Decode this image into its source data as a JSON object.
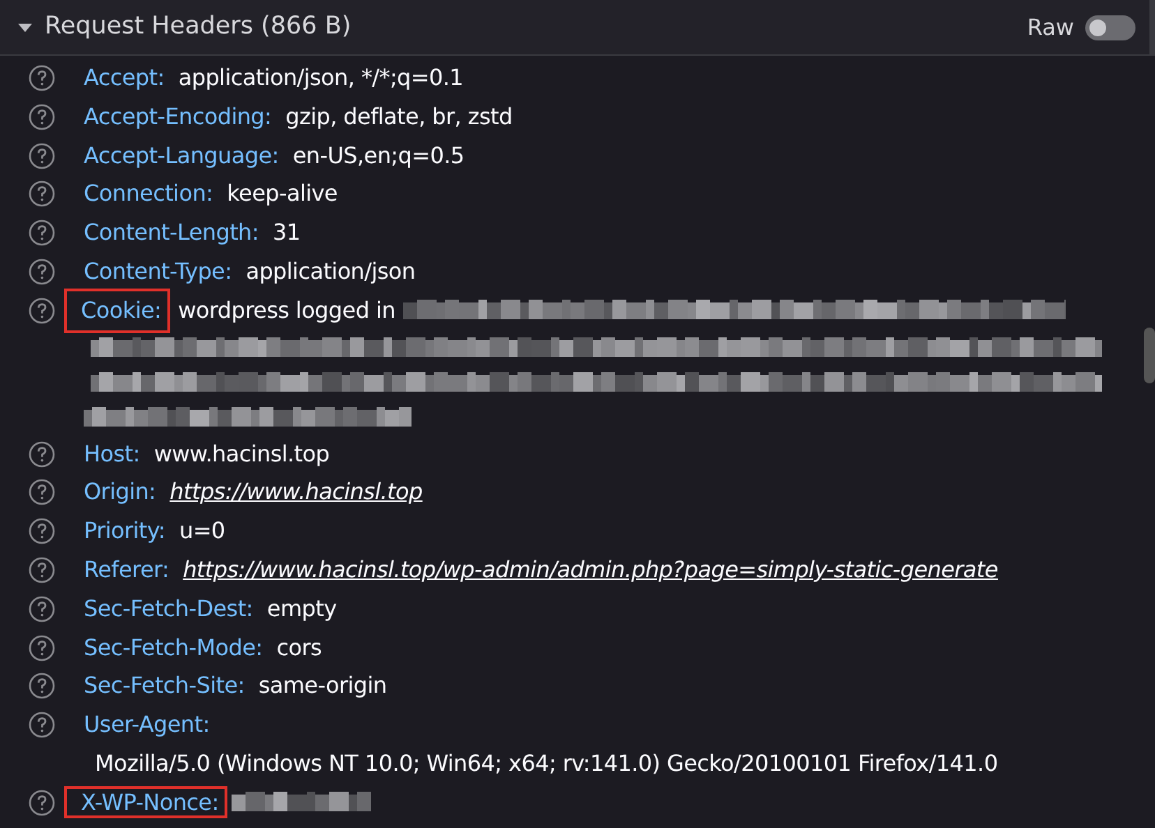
{
  "section": {
    "title": "Request Headers (866 B)",
    "expanded": true,
    "raw_toggle": {
      "label": "Raw",
      "on": false
    }
  },
  "headers": [
    {
      "name": "Accept:",
      "value": "application/json, */*;q=0.1",
      "kind": "text"
    },
    {
      "name": "Accept-Encoding:",
      "value": "gzip, deflate, br, zstd",
      "kind": "text"
    },
    {
      "name": "Accept-Language:",
      "value": "en-US,en;q=0.5",
      "kind": "text"
    },
    {
      "name": "Connection:",
      "value": "keep-alive",
      "kind": "text"
    },
    {
      "name": "Content-Length:",
      "value": "31",
      "kind": "text"
    },
    {
      "name": "Content-Type:",
      "value": "application/json",
      "kind": "text"
    },
    {
      "name": "Cookie:",
      "value": "wordpress logged in",
      "kind": "text",
      "annotated": true,
      "redacted": true
    },
    {
      "name": "Host:",
      "value": "www.hacinsl.top",
      "kind": "text"
    },
    {
      "name": "Origin:",
      "value": "https://www.hacinsl.top",
      "kind": "link"
    },
    {
      "name": "Priority:",
      "value": "u=0",
      "kind": "text"
    },
    {
      "name": "Referer:",
      "value": "https://www.hacinsl.top/wp-admin/admin.php?page=simply-static-generate",
      "kind": "link"
    },
    {
      "name": "Sec-Fetch-Dest:",
      "value": "empty",
      "kind": "text"
    },
    {
      "name": "Sec-Fetch-Mode:",
      "value": "cors",
      "kind": "text"
    },
    {
      "name": "Sec-Fetch-Site:",
      "value": "same-origin",
      "kind": "text"
    },
    {
      "name": "User-Agent:",
      "value": "Mozilla/5.0 (Windows NT 10.0; Win64; x64; rv:141.0) Gecko/20100101 Firefox/141.0",
      "kind": "text"
    },
    {
      "name": "X-WP-Nonce:",
      "annotated": true,
      "redacted": true
    }
  ]
}
